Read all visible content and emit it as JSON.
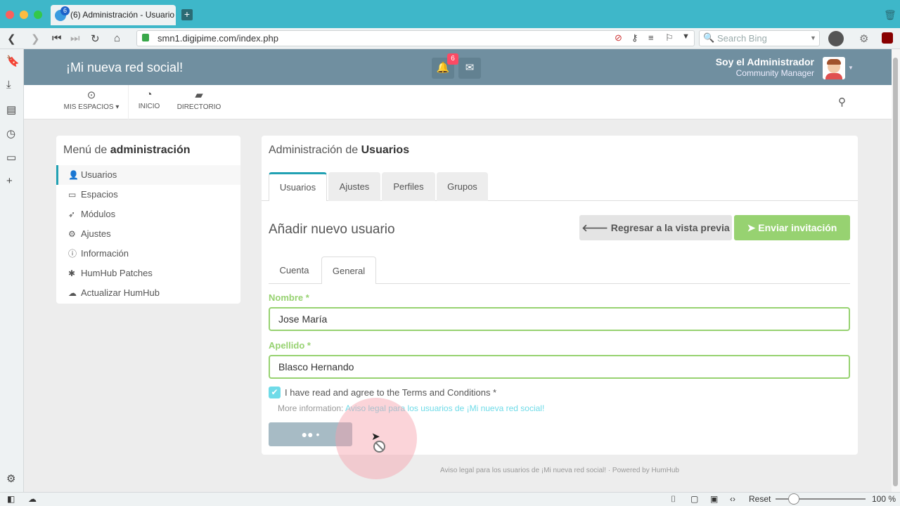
{
  "browser": {
    "tab_title": "(6) Administración - Usuario",
    "tab_badge": "6",
    "url": "smn1.digipime.com/index.php",
    "search_placeholder": "Search Bing",
    "reset_label": "Reset",
    "zoom": "100 %"
  },
  "app": {
    "brand": "¡Mi nueva red social!",
    "notifications_count": "6",
    "user_name": "Soy el Administrador",
    "user_role": "Community Manager",
    "subnav": {
      "spaces": "MIS ESPACIOS",
      "home": "INICIO",
      "directory": "DIRECTORIO"
    }
  },
  "admin_menu": {
    "title_prefix": "Menú de ",
    "title_bold": "administración",
    "items": [
      {
        "label": "Usuarios",
        "icon": "user-icon"
      },
      {
        "label": "Espacios",
        "icon": "inbox-icon"
      },
      {
        "label": "Módulos",
        "icon": "rocket-icon"
      },
      {
        "label": "Ajustes",
        "icon": "cogs-icon"
      },
      {
        "label": "Información",
        "icon": "info-icon"
      },
      {
        "label": "HumHub Patches",
        "icon": "bug-icon"
      },
      {
        "label": "Actualizar HumHub",
        "icon": "cloud-download-icon"
      }
    ]
  },
  "main": {
    "title_prefix": "Administración de ",
    "title_bold": "Usuarios",
    "tabs": [
      "Usuarios",
      "Ajustes",
      "Perfiles",
      "Grupos"
    ],
    "form_title": "Añadir nuevo usuario",
    "back_button": "Regresar a la vista previa",
    "invite_button": "Enviar invitación",
    "subtabs": [
      "Cuenta",
      "General"
    ],
    "first_name_label": "Nombre *",
    "first_name_value": "Jose María",
    "last_name_label": "Apellido *",
    "last_name_value": "Blasco Hernando",
    "terms_label": "I have read and agree to the Terms and Conditions *",
    "more_info_prefix": "More information: ",
    "more_info_link": "Aviso legal para los usuarios de ¡Mi nueva red social!",
    "save_button": "●● •"
  },
  "footer": {
    "text": "Aviso legal para los usuarios de ¡Mi nueva red social! · Powered by HumHub"
  },
  "colors": {
    "topnav": "#708fa0",
    "accent": "#21a1b3",
    "success": "#97d271",
    "info": "#6fdbe8"
  }
}
